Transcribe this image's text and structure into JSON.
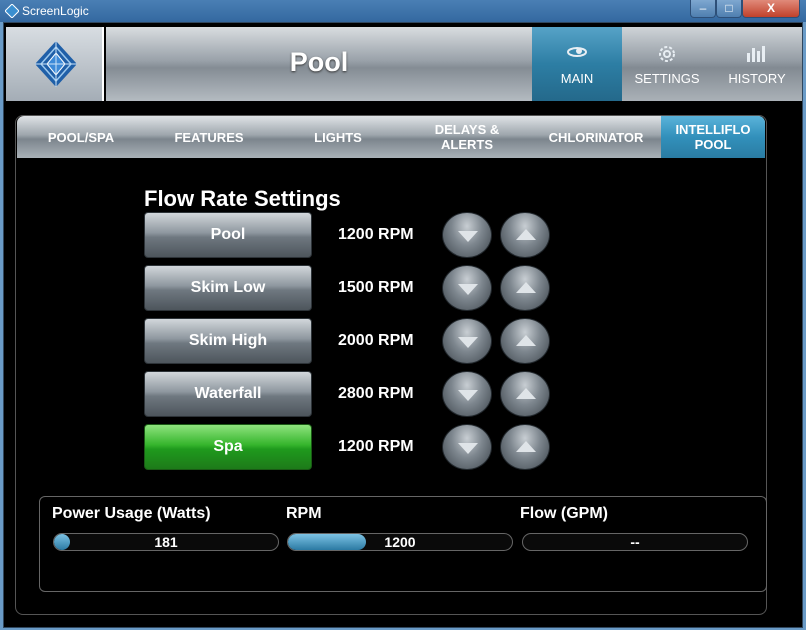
{
  "window": {
    "title": "ScreenLogic",
    "minimize": "–",
    "maximize": "□",
    "close": "X"
  },
  "header": {
    "title": "Pool",
    "nav": [
      {
        "label": "MAIN",
        "icon": "main-icon",
        "active": true
      },
      {
        "label": "SETTINGS",
        "icon": "gear-icon",
        "active": false
      },
      {
        "label": "HISTORY",
        "icon": "chart-icon",
        "active": false
      }
    ]
  },
  "tabs": [
    {
      "label": "POOL/SPA",
      "active": false
    },
    {
      "label": "FEATURES",
      "active": false
    },
    {
      "label": "LIGHTS",
      "active": false
    },
    {
      "label": "DELAYS & ALERTS",
      "active": false
    },
    {
      "label": "CHLORINATOR",
      "active": false
    },
    {
      "label": "INTELLIFLO POOL",
      "active": true
    }
  ],
  "flow": {
    "title": "Flow Rate Settings",
    "rows": [
      {
        "label": "Pool",
        "rpm": "1200 RPM",
        "active": false
      },
      {
        "label": "Skim Low",
        "rpm": "1500 RPM",
        "active": false
      },
      {
        "label": "Skim High",
        "rpm": "2000 RPM",
        "active": false
      },
      {
        "label": "Waterfall",
        "rpm": "2800 RPM",
        "active": false
      },
      {
        "label": "Spa",
        "rpm": "1200 RPM",
        "active": true
      }
    ]
  },
  "readouts": {
    "power": {
      "label": "Power Usage (Watts)",
      "value": "181",
      "fill_fraction": 0.05
    },
    "rpm": {
      "label": "RPM",
      "value": "1200",
      "fill_fraction": 0.35
    },
    "flow": {
      "label": "Flow (GPM)",
      "value": "--",
      "fill_fraction": 0
    }
  },
  "colors": {
    "accent": "#2d7ea4",
    "active_mode": "#1f9a1d"
  }
}
